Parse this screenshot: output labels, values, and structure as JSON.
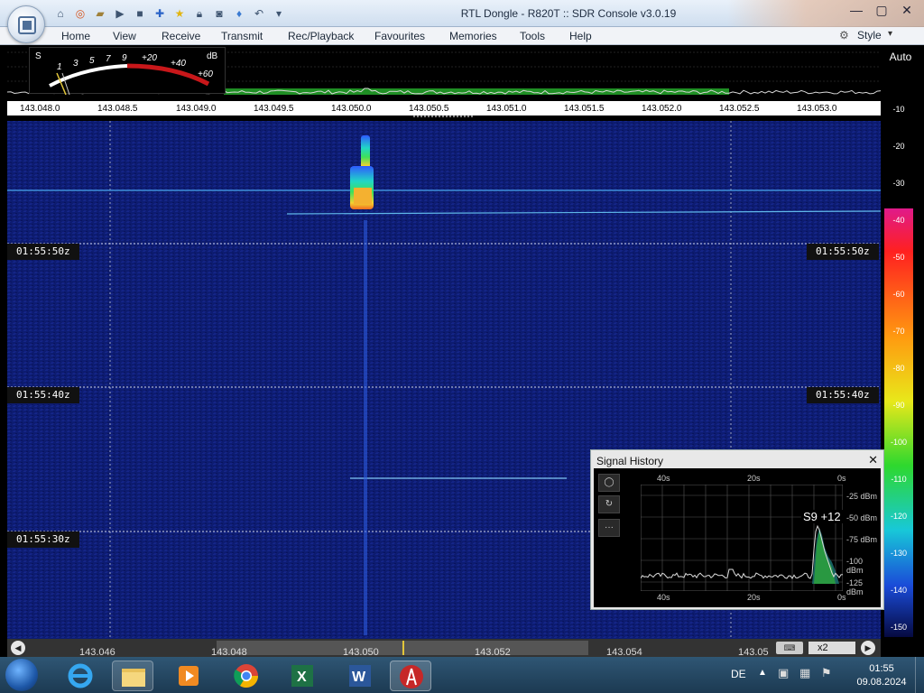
{
  "window": {
    "title": "RTL Dongle - R820T :: SDR Console v3.0.19"
  },
  "menu": {
    "items": [
      "Home",
      "View",
      "Receive",
      "Transmit",
      "Rec/Playback",
      "Favourites",
      "Memories",
      "Tools",
      "Help"
    ],
    "style_label": "Style"
  },
  "smeter": {
    "s_label": "S",
    "db_label": "dB",
    "scale": [
      "1",
      "3",
      "5",
      "7",
      "9",
      "+20",
      "+40",
      "+60"
    ]
  },
  "auto_label": "Auto",
  "ruler": {
    "ticks": [
      "143.048.0",
      "143.048.5",
      "143.049.0",
      "143.049.5",
      "143.050.0",
      "143.050.5",
      "143.051.0",
      "143.051.5",
      "143.052.0",
      "143.052.5",
      "143.053.0"
    ]
  },
  "db_scale": [
    "-10",
    "-20",
    "-30",
    "-40",
    "-50",
    "-60",
    "-70",
    "-80",
    "-90",
    "-100",
    "-110",
    "-120",
    "-130",
    "-140",
    "-150"
  ],
  "waterfall": {
    "time_labels": [
      "01:55:50z",
      "01:55:40z",
      "01:55:30z"
    ]
  },
  "bottom_band": {
    "freqs": [
      "143.046",
      "143.048",
      "143.050",
      "143.052",
      "143.054",
      "143.05"
    ],
    "zoom_label": "x2"
  },
  "signal_history": {
    "title": "Signal History",
    "time_top": [
      "40s",
      "20s",
      "0s"
    ],
    "time_bottom": [
      "40s",
      "20s",
      "0s"
    ],
    "levels": [
      "-25 dBm",
      "-50 dBm",
      "-75 dBm",
      "-100 dBm",
      "-125 dBm"
    ],
    "reading": "S9 +12"
  },
  "taskbar": {
    "language": "DE",
    "time": "01:55",
    "date": "09.08.2024"
  }
}
